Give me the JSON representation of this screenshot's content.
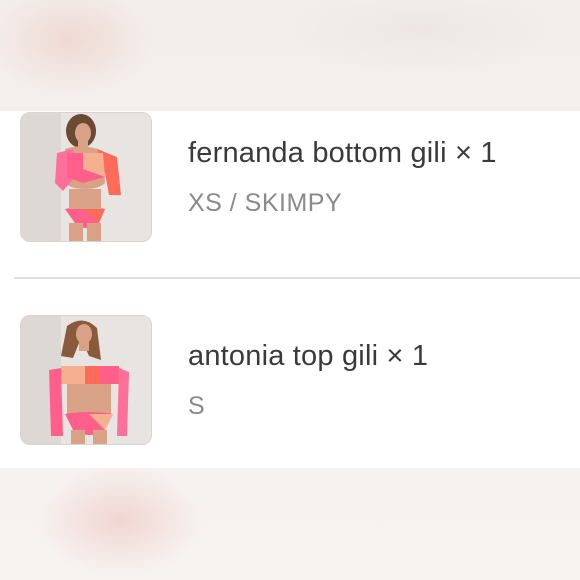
{
  "order_items": [
    {
      "name": "fernanda bottom gili",
      "quantity": "× 1",
      "variant": "XS / SKIMPY",
      "thumbnail_icon": "product-photo"
    },
    {
      "name": "antonia top gili",
      "quantity": "× 1",
      "variant": "S",
      "thumbnail_icon": "product-photo"
    }
  ],
  "colors": {
    "title_text": "#3a3a3a",
    "variant_text": "#8a8a8a",
    "card_bg": "#ffffff",
    "divider": "#e2e0df",
    "swim_pink": "#ff5f8a",
    "swim_coral": "#ff6b5a",
    "swim_peach": "#f7b08f"
  }
}
